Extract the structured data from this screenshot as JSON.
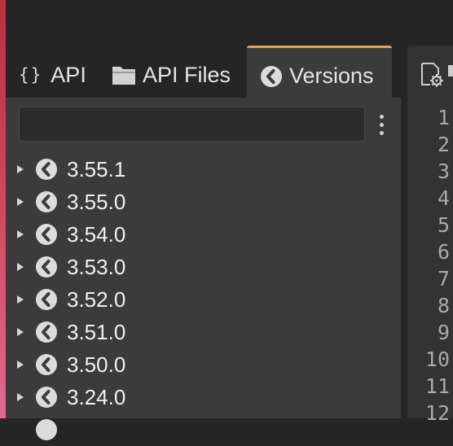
{
  "tabs": {
    "api": {
      "icon": "braces-icon",
      "icon_text": "{}",
      "label": "API"
    },
    "files": {
      "icon": "folder-icon",
      "label": "API Files"
    },
    "versions": {
      "icon": "version-icon",
      "label": "Versions",
      "active": true
    }
  },
  "search": {
    "value": "",
    "placeholder": ""
  },
  "accent_color": "#e9a24c",
  "versions": [
    "3.55.1",
    "3.55.0",
    "3.54.0",
    "3.53.0",
    "3.52.0",
    "3.51.0",
    "3.50.0",
    "3.24.0"
  ],
  "editor": {
    "line_numbers": [
      "1",
      "2",
      "3",
      "4",
      "5",
      "6",
      "7",
      "8",
      "9",
      "10",
      "11",
      "12"
    ]
  }
}
